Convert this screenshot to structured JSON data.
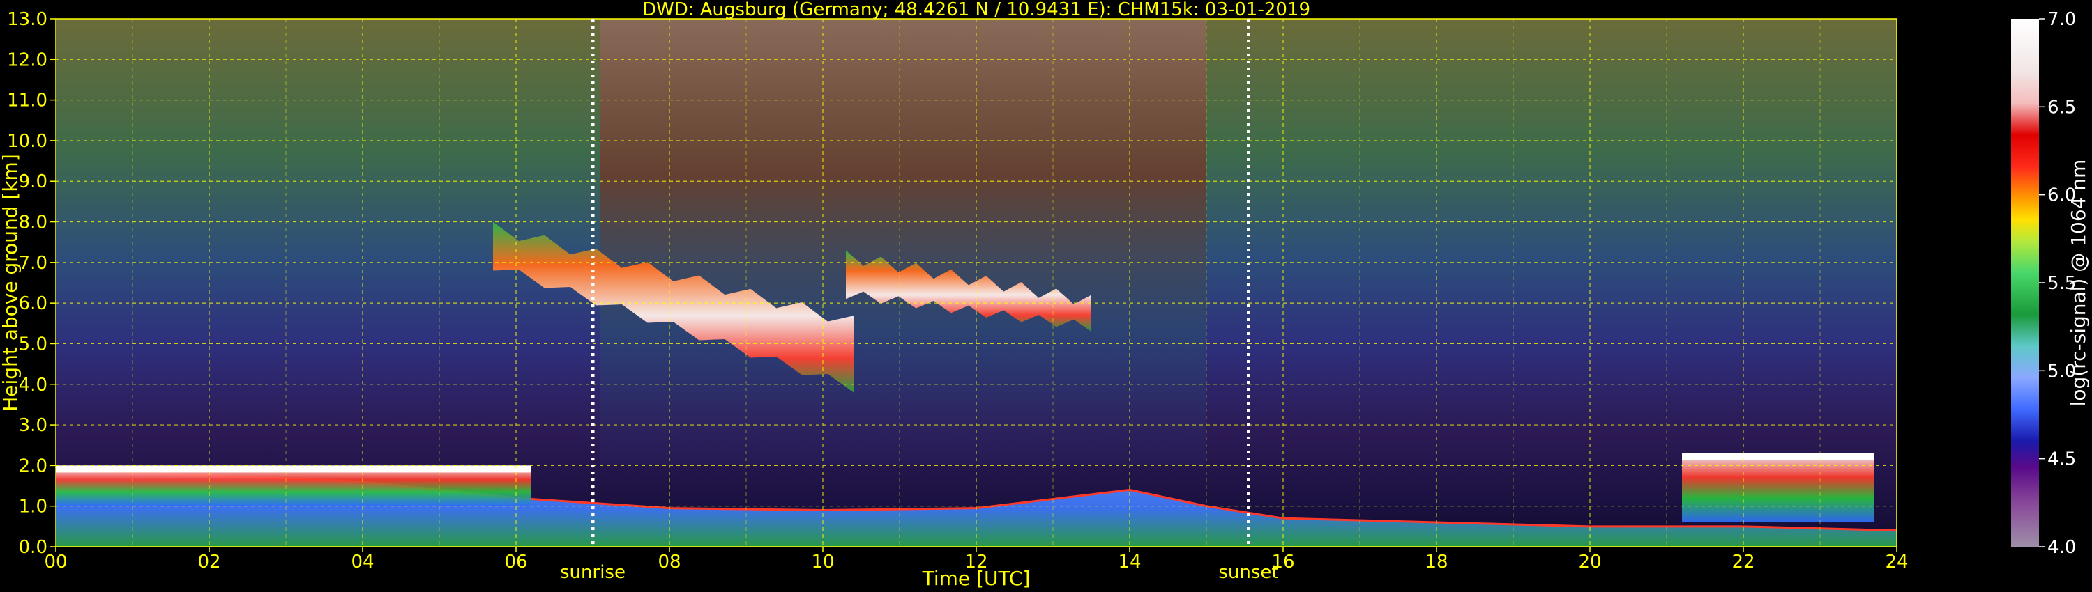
{
  "chart_data": {
    "type": "heatmap",
    "title": "DWD: Augsburg (Germany; 48.4261 N / 10.9431 E):    CHM15k: 03-01-2019",
    "xlabel": "Time [UTC]",
    "ylabel": "Height above ground [km]",
    "xlim": [
      0,
      24
    ],
    "ylim": [
      0,
      13
    ],
    "x_ticks": [
      "00",
      "02",
      "04",
      "06",
      "08",
      "10",
      "12",
      "14",
      "16",
      "18",
      "20",
      "22",
      "24"
    ],
    "y_ticks": [
      "0.0",
      "1.0",
      "2.0",
      "3.0",
      "4.0",
      "5.0",
      "6.0",
      "7.0",
      "8.0",
      "9.0",
      "10.0",
      "11.0",
      "12.0",
      "13.0"
    ],
    "grid": true,
    "sunrise": {
      "label": "sunrise",
      "time": 7.0
    },
    "sunset": {
      "label": "sunset",
      "time": 15.55
    },
    "colorbar": {
      "label": "log(rc-signal) @ 1064 nm",
      "range": [
        4.0,
        7.0
      ],
      "ticks": [
        "4.0",
        "4.5",
        "5.0",
        "5.5",
        "6.0",
        "6.5",
        "7.0"
      ]
    },
    "features": [
      {
        "kind": "boundary-layer",
        "t_start": 0,
        "t_end": 24,
        "top_km": [
          [
            0,
            1.9
          ],
          [
            2,
            1.75
          ],
          [
            4,
            1.6
          ],
          [
            6,
            1.2
          ],
          [
            8,
            0.95
          ],
          [
            10,
            0.9
          ],
          [
            12,
            0.95
          ],
          [
            14,
            1.4
          ],
          [
            15,
            1.0
          ],
          [
            16,
            0.7
          ],
          [
            18,
            0.6
          ],
          [
            20,
            0.5
          ],
          [
            22,
            0.5
          ],
          [
            24,
            0.4
          ]
        ]
      },
      {
        "kind": "low-cloud",
        "t_start": 0,
        "t_end": 6.2,
        "base_km": 1.0,
        "top_km": 2.0
      },
      {
        "kind": "cirrus",
        "t_start": 5.7,
        "t_end": 10.4,
        "base_km": 3.8,
        "top_km": 8.0
      },
      {
        "kind": "cirrus",
        "t_start": 10.3,
        "t_end": 13.5,
        "base_km": 5.3,
        "top_km": 7.3
      },
      {
        "kind": "low-cloud",
        "t_start": 21.2,
        "t_end": 23.7,
        "base_km": 0.6,
        "top_km": 2.3
      }
    ]
  }
}
